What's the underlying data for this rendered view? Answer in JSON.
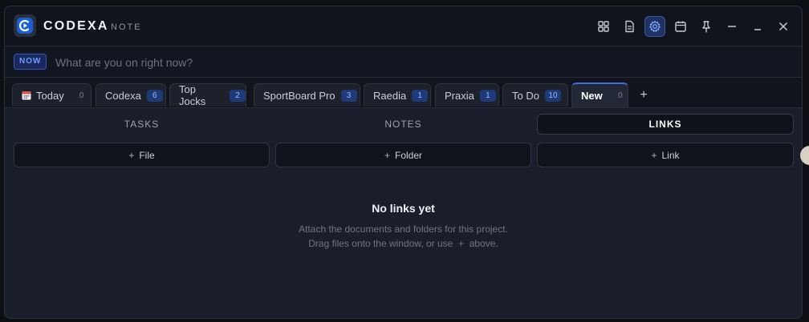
{
  "app": {
    "brand": "CODEXA",
    "brand_sub": "NOTE"
  },
  "toolbar": {
    "icons": [
      "grid-icon",
      "document-icon",
      "gear-icon",
      "calendar-icon",
      "pin-icon",
      "minimize-icon",
      "restore-icon",
      "close-icon"
    ],
    "active_icon": "gear-icon"
  },
  "now_bar": {
    "badge": "NOW",
    "placeholder": "What are you on right now?",
    "value": ""
  },
  "tabs": [
    {
      "label": "Today",
      "count": "0",
      "icon": "calendar-icon"
    },
    {
      "label": "Codexa",
      "count": "6"
    },
    {
      "label": "Top Jocks",
      "count": "2"
    },
    {
      "label": "SportBoard Pro",
      "count": "3"
    },
    {
      "label": "Raedia",
      "count": "1"
    },
    {
      "label": "Praxia",
      "count": "1"
    },
    {
      "label": "To Do",
      "count": "10"
    },
    {
      "label": "New",
      "count": "0",
      "active": true
    }
  ],
  "add_tab": "+",
  "sections": {
    "tasks": "TASKS",
    "notes": "NOTES",
    "links": "LINKS",
    "active": "LINKS"
  },
  "actions": {
    "file": "File",
    "folder": "Folder",
    "link": "Link",
    "plus": "+"
  },
  "empty_state": {
    "title": "No links yet",
    "line1": "Attach the documents and folders for this project.",
    "line2": "Drag files onto the window, or use  +  above."
  },
  "colors": {
    "accent": "#3f6fe0",
    "badge_bg": "#1e3a78",
    "window_bg": "#1a1e2a"
  }
}
